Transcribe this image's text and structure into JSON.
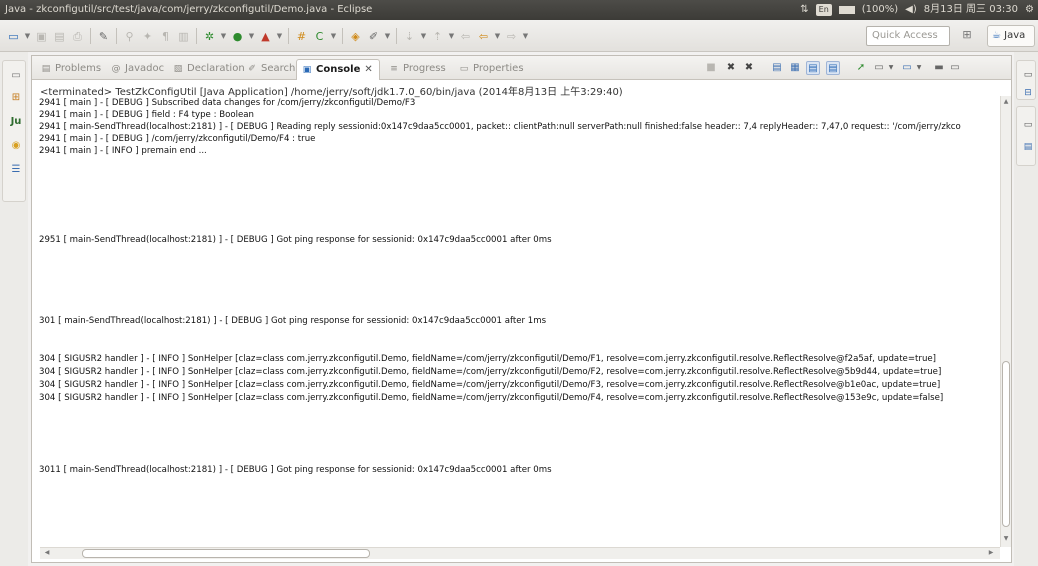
{
  "window": {
    "title": "Java - zkconfigutil/src/test/java/com/jerry/zkconfigutil/Demo.java - Eclipse"
  },
  "tray": {
    "input_method": "En",
    "battery": "(100%)",
    "datetime": "8月13日 周三 03:30"
  },
  "toolbar": {
    "quick_access_placeholder": "Quick Access",
    "perspective_java": "Java"
  },
  "tabs": [
    {
      "label": "Problems",
      "icon": "problems-icon"
    },
    {
      "label": "Javadoc",
      "icon": "at-icon"
    },
    {
      "label": "Declaration",
      "icon": "declaration-icon"
    },
    {
      "label": "Search",
      "icon": "search-icon"
    },
    {
      "label": "Console",
      "icon": "console-icon",
      "active": true
    },
    {
      "label": "Progress",
      "icon": "progress-icon"
    },
    {
      "label": "Properties",
      "icon": "properties-icon"
    }
  ],
  "console": {
    "header": "<terminated> TestZkConfigUtil [Java Application] /home/jerry/soft/jdk1.7.0_60/bin/java (2014年8月13日 上午3:29:40)",
    "lines": [
      "2941  [ main ] - [ DEBUG ]  Subscribed data changes for /com/jerry/zkconfigutil/Demo/F3",
      "2941  [ main ] - [ DEBUG ]  field : F4   type : Boolean",
      "2941  [ main-SendThread(localhost:2181) ] - [ DEBUG ]  Reading reply sessionid:0x147c9daa5cc0001, packet:: clientPath:null serverPath:null finished:false header:: 7,4  replyHeader:: 7,47,0  request:: '/com/jerry/zkco",
      "2941  [ main ] - [ DEBUG ]  /com/jerry/zkconfigutil/Demo/F4 : true",
      "2941  [ main ] - [ INFO ]  premain end ...",
      "2951  [ main-SendThread(localhost:2181) ] - [ DEBUG ]  Got ping response for sessionid: 0x147c9daa5cc0001 after 0ms",
      "301  [ main-SendThread(localhost:2181) ] - [ DEBUG ]  Got ping response for sessionid: 0x147c9daa5cc0001 after 1ms",
      "304  [ SIGUSR2 handler ] - [ INFO ]  SonHelper [claz=class com.jerry.zkconfigutil.Demo, fieldName=/com/jerry/zkconfigutil/Demo/F1, resolve=com.jerry.zkconfigutil.resolve.ReflectResolve@f2a5af, update=true]",
      "304  [ SIGUSR2 handler ] - [ INFO ]  SonHelper [claz=class com.jerry.zkconfigutil.Demo, fieldName=/com/jerry/zkconfigutil/Demo/F2, resolve=com.jerry.zkconfigutil.resolve.ReflectResolve@5b9d44, update=true]",
      "304  [ SIGUSR2 handler ] - [ INFO ]  SonHelper [claz=class com.jerry.zkconfigutil.Demo, fieldName=/com/jerry/zkconfigutil/Demo/F3, resolve=com.jerry.zkconfigutil.resolve.ReflectResolve@b1e0ac, update=true]",
      "304  [ SIGUSR2 handler ] - [ INFO ]  SonHelper [claz=class com.jerry.zkconfigutil.Demo, fieldName=/com/jerry/zkconfigutil/Demo/F4, resolve=com.jerry.zkconfigutil.resolve.ReflectResolve@153e9c, update=false]",
      "3011  [ main-SendThread(localhost:2181) ] - [ DEBUG ]  Got ping response for sessionid: 0x147c9daa5cc0001 after 0ms"
    ]
  },
  "colors": {
    "titlebar": "#3c3b37",
    "accent": "#2a69b6"
  }
}
